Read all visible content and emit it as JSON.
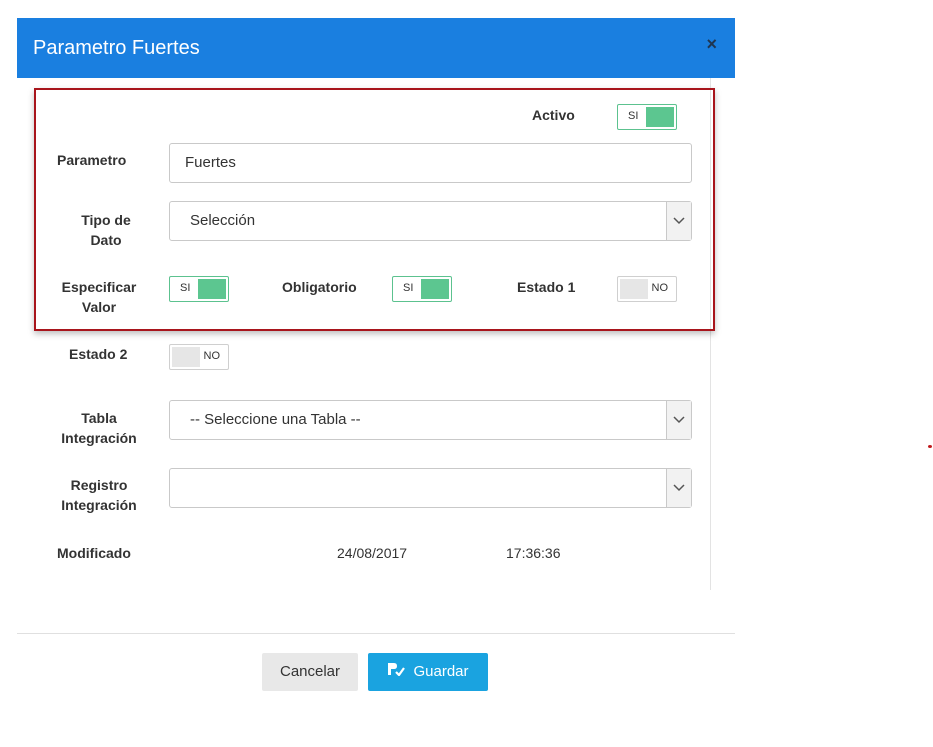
{
  "modal": {
    "title": "Parametro Fuertes",
    "close_symbol": "×"
  },
  "form": {
    "activo": {
      "label": "Activo",
      "toggle_text": "SI",
      "state": "on"
    },
    "parametro": {
      "label": "Parametro",
      "value": "Fuertes"
    },
    "tipo_dato": {
      "label_line1": "Tipo de",
      "label_line2": "Dato",
      "value": "Selección"
    },
    "especificar_valor": {
      "label_line1": "Especificar",
      "label_line2": "Valor",
      "toggle_text": "SI",
      "state": "on"
    },
    "obligatorio": {
      "label": "Obligatorio",
      "toggle_text": "SI",
      "state": "on"
    },
    "estado1": {
      "label": "Estado 1",
      "toggle_text": "NO",
      "state": "off"
    },
    "estado2": {
      "label": "Estado 2",
      "toggle_text": "NO",
      "state": "off"
    },
    "tabla_integracion": {
      "label_line1": "Tabla",
      "label_line2": "Integración",
      "value": "-- Seleccione una Tabla --"
    },
    "registro_integracion": {
      "label_line1": "Registro",
      "label_line2": "Integración",
      "value": ""
    },
    "modificado": {
      "label": "Modificado",
      "date": "24/08/2017",
      "time": "17:36:36"
    }
  },
  "footer": {
    "cancel_label": "Cancelar",
    "save_label": "Guardar"
  },
  "colors": {
    "header": "#1a7fe0",
    "toggle_on": "#5cc690",
    "highlight_border": "#a8151c",
    "save_button": "#1aa3e0"
  }
}
